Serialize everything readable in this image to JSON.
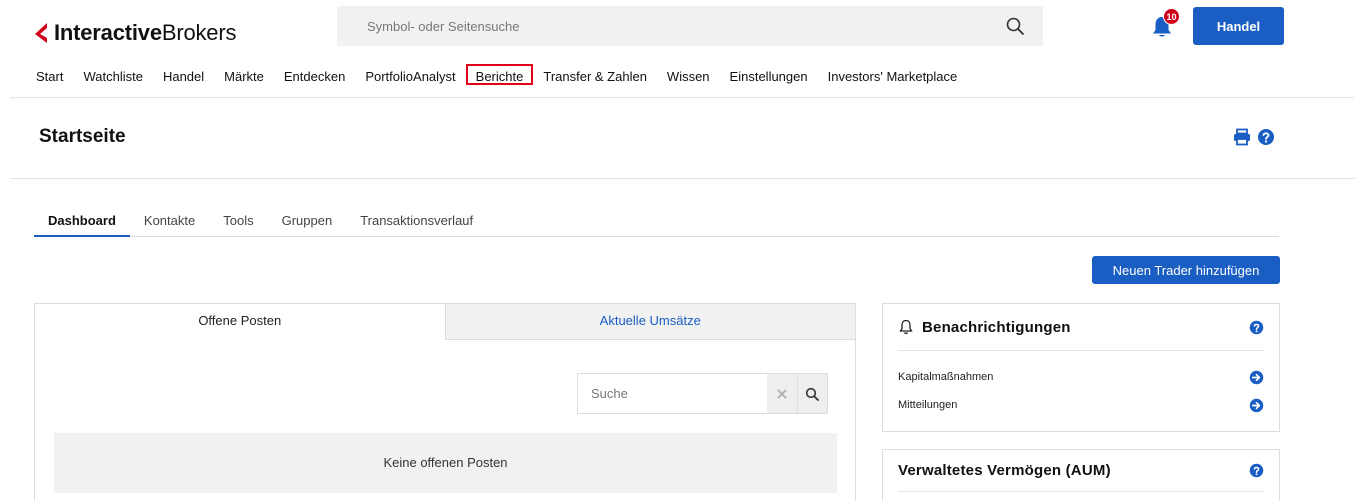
{
  "header": {
    "logo_bold": "Interactive",
    "logo_light": "Brokers",
    "search_placeholder": "Symbol- oder Seitensuche",
    "notification_count": "10",
    "trade_button": "Handel"
  },
  "nav": {
    "items": [
      "Start",
      "Watchliste",
      "Handel",
      "Märkte",
      "Entdecken",
      "PortfolioAnalyst",
      "Berichte",
      "Transfer & Zahlen",
      "Wissen",
      "Einstellungen",
      "Investors' Marketplace"
    ],
    "highlighted": "Berichte"
  },
  "page": {
    "title": "Startseite"
  },
  "tabs": [
    "Dashboard",
    "Kontakte",
    "Tools",
    "Gruppen",
    "Transaktionsverlauf"
  ],
  "add_trader_button": "Neuen Trader hinzufügen",
  "positions": {
    "tab_open": "Offene Posten",
    "tab_recent": "Aktuelle Umsätze",
    "search_placeholder": "Suche",
    "empty_text": "Keine offenen Posten"
  },
  "notifications": {
    "title": "Benachrichtigungen",
    "items": [
      "Kapitalmaßnahmen",
      "Mitteilungen"
    ]
  },
  "aum": {
    "title": "Verwaltetes Vermögen (AUM)"
  },
  "colors": {
    "brand_blue": "#1a5ec4",
    "brand_red": "#d0021b",
    "highlight_red": "#e0001b"
  }
}
